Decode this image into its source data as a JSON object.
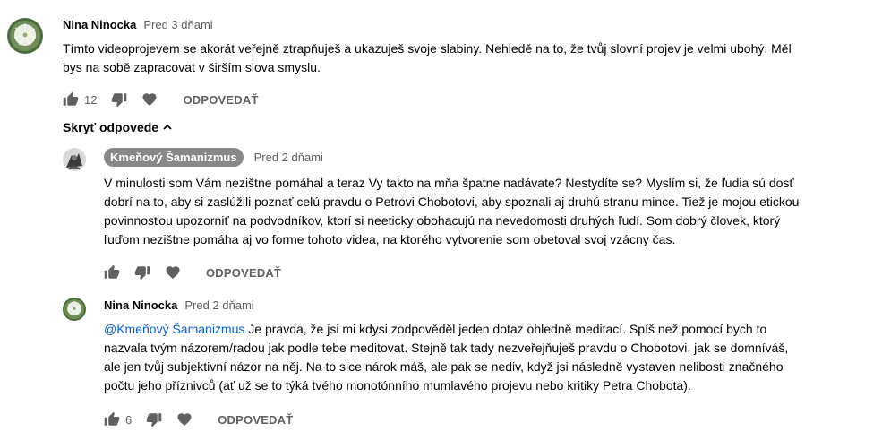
{
  "comments": [
    {
      "author": "Nina Ninocka",
      "time": "Pred 3 dňami",
      "lines": [
        "Tímto videoprojevem  se akorát veřejně ztrapňuješ a ukazuješ svoje slabiny. Nehledě na to, že tvůj slovní projev je velmi ubohý. Měl",
        "bys na sobě zapracovat v širším slova smyslu."
      ],
      "likes": "12",
      "reply_label": "ODPOVEDAŤ"
    }
  ],
  "toggle_label": "Skryť odpovede",
  "replies": [
    {
      "author": "Kmeňový Šamanizmus",
      "time": "Pred 2 dňami",
      "lines": [
        "V minulosti som Vám nezištne pomáhal a teraz Vy takto na mňa špatne nadávate? Nestydíte se? Myslím si, že ľudia sú dosť",
        "dobrí na to, aby si zaslúžili poznať celú pravdu o Petrovi Chobotovi, aby spoznali aj druhú stranu mince. Tiež je mojou etickou",
        "povinnosťou upozorniť na podvodníkov, ktorí si neeticky obohacujú na nevedomosti druhých ľudí. Som dobrý človek, ktorý",
        "ľuďom nezištne pomáha aj vo forme tohoto videa, na ktorého vytvorenie som obetoval svoj vzácny čas."
      ],
      "reply_label": "ODPOVEDAŤ"
    },
    {
      "author": "Nina Ninocka",
      "time": "Pred 2 dňami",
      "mention": "@Kmeňový Šamanizmus",
      "first_line_rest": " Je pravda, že jsi mi kdysi zodpověděl jeden dotaz ohledně meditací. Spíš než pomocí bych to",
      "lines": [
        "nazvala tvým názorem/radou jak podle tebe meditovat.  Stejně tak tady nezveřejňuješ pravdu o Chobotovi, jak se domníváš,",
        "ale jen tvůj subjektivní názor na něj. Na to sice nárok máš, ale pak se nediv, když jsi následně vystaven nelibosti značného",
        "počtu jeho příznivců (ať už se to týká tvého monotónního mumlavého projevu nebo kritiky Petra Chobota)."
      ],
      "likes": "6",
      "reply_label": "ODPOVEDAŤ"
    }
  ],
  "icons": [
    "thumb-up-icon",
    "thumb-down-icon",
    "heart-icon",
    "chevron-up-icon"
  ],
  "colors": {
    "text": "#030303",
    "secondary": "#606060",
    "mention": "#065fd4",
    "badge": "#888888"
  }
}
